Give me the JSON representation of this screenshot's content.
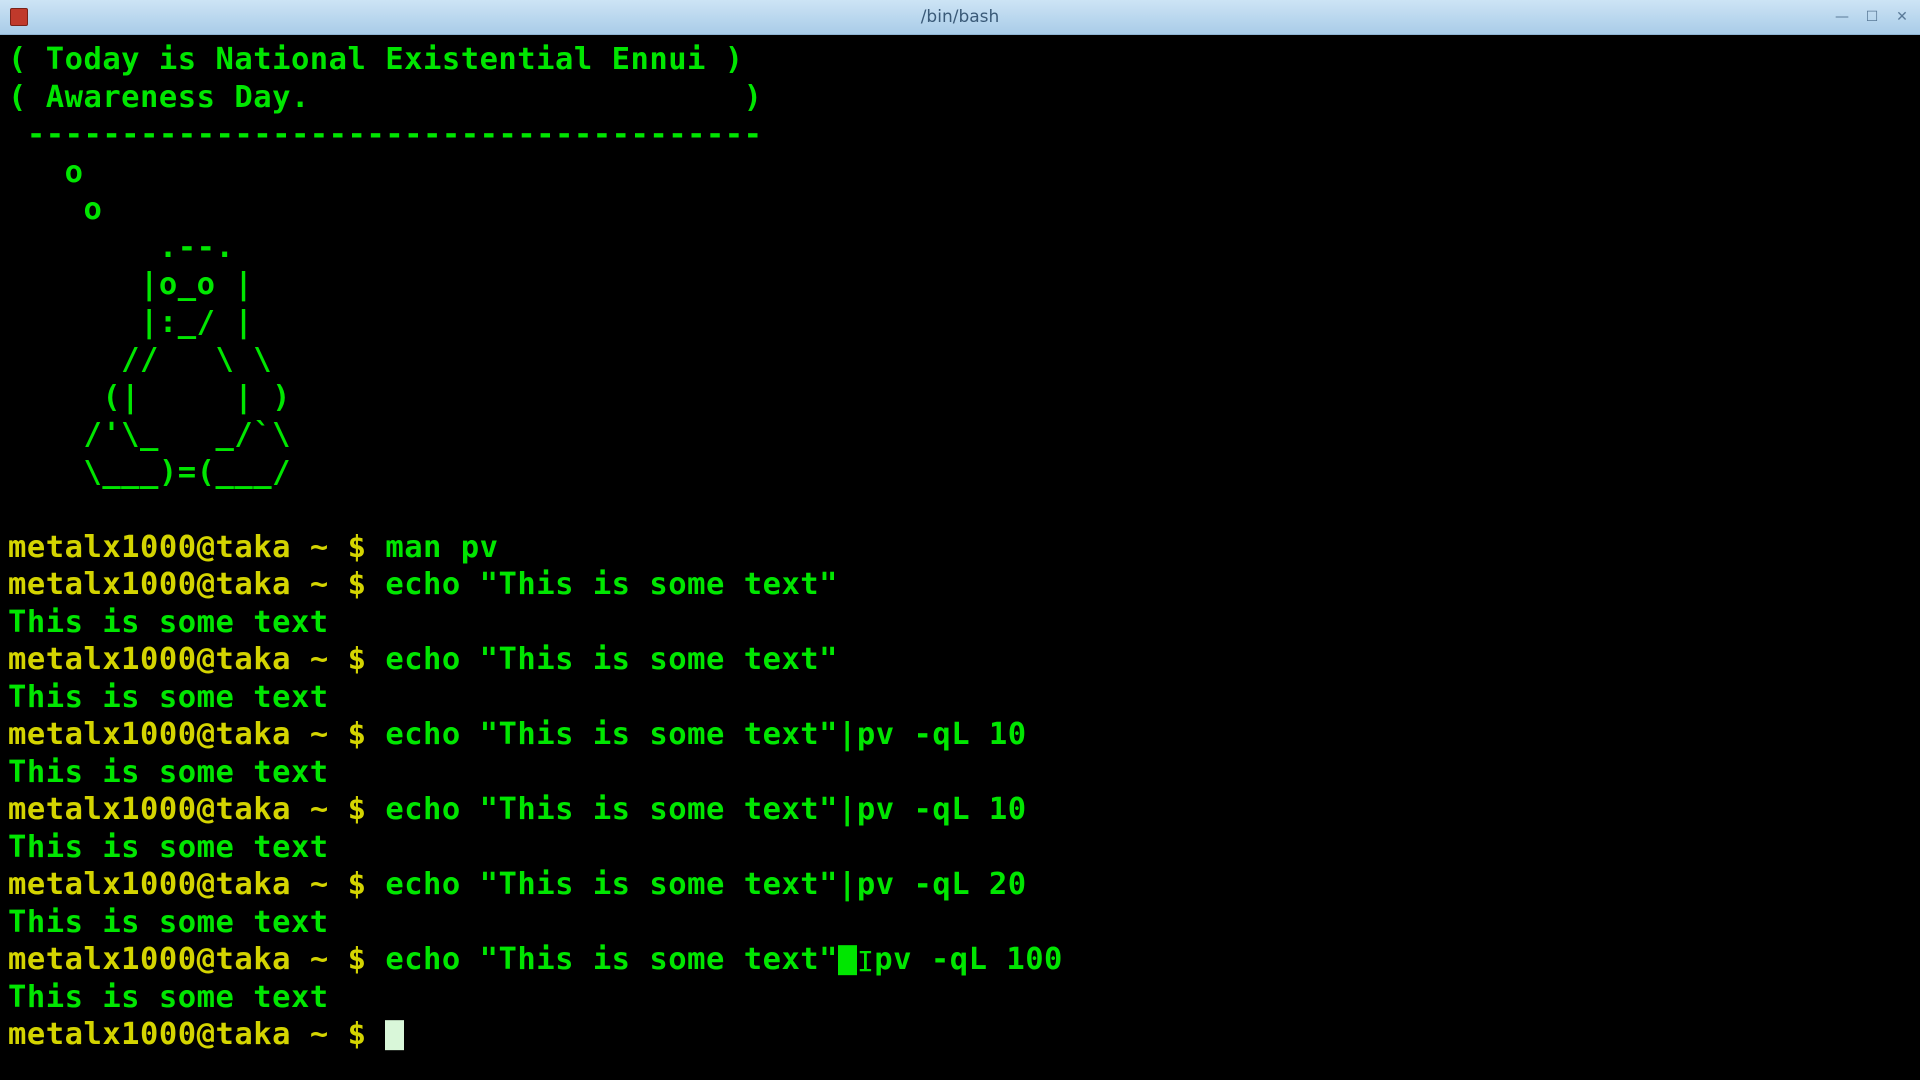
{
  "window": {
    "title": "/bin/bash"
  },
  "motd": {
    "line1": "( Today is National Existential Ennui )",
    "line2": "( Awareness Day.                       )",
    "sep": " ---------------------------------------",
    "o1": "   o",
    "o2": "    o",
    "tux1": "        .--.",
    "tux2": "       |o_o |",
    "tux3": "       |:_/ |",
    "tux4": "      //   \\ \\",
    "tux5": "     (|     | )",
    "tux6": "    /'\\_   _/`\\",
    "tux7": "    \\___)=(___/"
  },
  "prompt": {
    "user_host": "metalx1000@taka",
    "path": "~",
    "symbol": "$"
  },
  "history": [
    {
      "cmd": "man pv",
      "out": null
    },
    {
      "cmd": "echo \"This is some text\"",
      "out": "This is some text"
    },
    {
      "cmd": "echo \"This is some text\"",
      "out": "This is some text"
    },
    {
      "cmd": "echo \"This is some text\"|pv -qL 10",
      "out": "This is some text"
    },
    {
      "cmd": "echo \"This is some text\"|pv -qL 10",
      "out": "This is some text"
    },
    {
      "cmd": "echo \"This is some text\"|pv -qL 20",
      "out": "This is some text"
    }
  ],
  "current": {
    "cmd_before_cursor": "echo \"This is some text\"",
    "cmd_after_cursor": "pv -qL 100",
    "out": "This is some text"
  }
}
